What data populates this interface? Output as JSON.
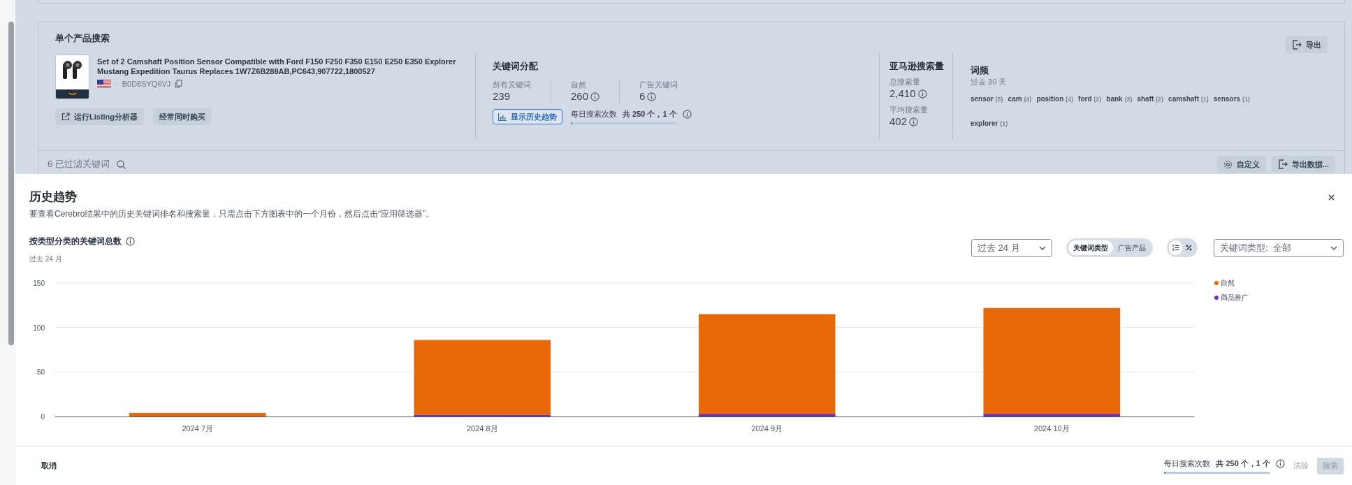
{
  "top_card": {
    "title": "单个产品搜索",
    "export_button": "导出",
    "product": {
      "title": "Set of 2 Camshaft Position Sensor Compatible with Ford F150 F250 F350 E150 E250 E350 Explorer Mustang Expedition Taurus Replaces 1W7Z6B288AB,PC643,907722,1800527",
      "separator": "·",
      "asin": "B0D8SYQ6VJ",
      "buttons": [
        "运行Listing分析器",
        "经常同时购买"
      ]
    },
    "keyword_distribution": {
      "title": "关键词分配",
      "stats": [
        {
          "label": "所有关键词",
          "value": "239",
          "info": false
        },
        {
          "label": "自然",
          "value": "260",
          "info": true
        },
        {
          "label": "广告关键词",
          "value": "6",
          "info": true
        }
      ],
      "history_button": "显示历史趋势",
      "daily_searches": {
        "label": "每日搜索次数",
        "count": "共 250 个，1 个",
        "level": 0.01
      }
    },
    "amazon_search_volume": {
      "title": "亚马逊搜索量",
      "stats": [
        {
          "label": "总搜索量",
          "value": "2,410"
        },
        {
          "label": "平均搜索量",
          "value": "402"
        }
      ]
    },
    "word_frequency": {
      "title": "词频",
      "period": "过去 30 天",
      "words": [
        {
          "word": "sensor",
          "count": "(5)"
        },
        {
          "word": "cam",
          "count": "(4)"
        },
        {
          "word": "position",
          "count": "(4)"
        },
        {
          "word": "ford",
          "count": "(2)"
        },
        {
          "word": "bank",
          "count": "(2)"
        },
        {
          "word": "shaft",
          "count": "(2)"
        },
        {
          "word": "camshaft",
          "count": "(1)"
        },
        {
          "word": "sensors",
          "count": "(1)"
        },
        {
          "word": "explorer",
          "count": "(1)"
        }
      ]
    },
    "filtered_count": "6 已过滤关键词",
    "customize_button": "自定义",
    "export_data_button": "导出数据..."
  },
  "modal": {
    "title": "历史趋势",
    "description": "要查看Cerebro结果中的历史关键词排名和搜索量，只需点击下方图表中的一个月份，然后点击“应用筛选器”。",
    "chart_title": "按类型分类的关键词总数",
    "chart_subtitle": "过去 24 月",
    "period_select": "过去 24 月",
    "type_toggle": [
      {
        "label": "关键词类型",
        "selected": true
      },
      {
        "label": "广告产品",
        "selected": false
      }
    ],
    "display_toggle": [
      {
        "kind": "count",
        "selected": true
      },
      {
        "kind": "percent",
        "selected": false
      }
    ],
    "keyword_type_select": "关键词类型:  全部",
    "chart_data": {
      "type": "bar",
      "stacked": true,
      "categories": [
        "2024 7月",
        "2024 8月",
        "2024 9月",
        "2024 10月"
      ],
      "ylim": [
        0,
        150
      ],
      "yticks": [
        0,
        50,
        100,
        150
      ],
      "series": [
        {
          "name": "自然",
          "color": "#e8690a",
          "values": [
            4,
            84,
            112,
            119
          ]
        },
        {
          "name": "商品推广",
          "color": "#6a2fbf",
          "values": [
            0,
            2,
            3,
            3
          ]
        }
      ]
    },
    "cancel_button": "取消",
    "daily_searches": {
      "label": "每日搜索次数",
      "count": "共 250 个，1 个",
      "level": 0.01
    },
    "clear_button": "清除",
    "search_button": {
      "label": "搜索",
      "disabled": true
    }
  }
}
